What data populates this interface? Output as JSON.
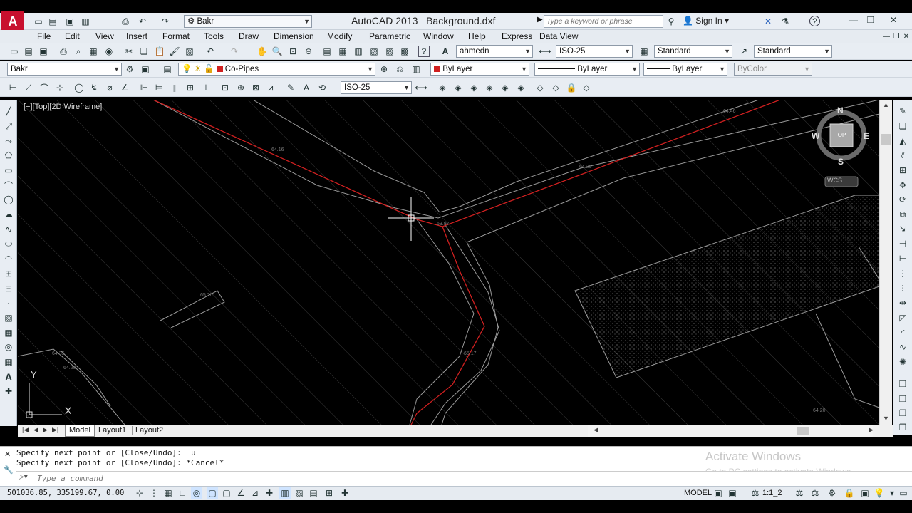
{
  "title_bar": {
    "workspace": "Bakr",
    "app_title": "AutoCAD 2013",
    "file_name": "Background.dxf",
    "search_placeholder": "Type a keyword or phrase",
    "sign_in": "Sign In"
  },
  "menu": {
    "items": [
      "File",
      "Edit",
      "View",
      "Insert",
      "Format",
      "Tools",
      "Draw",
      "Dimension",
      "Modify",
      "Parametric",
      "Window",
      "Help",
      "Express",
      "Data View"
    ]
  },
  "styles_toolbar": {
    "text_style": "ahmedn",
    "dim_style": "ISO-25",
    "table_style": "Standard",
    "multileader_style": "Standard"
  },
  "layers_toolbar": {
    "workspace": "Bakr",
    "layer": "Co-Pipes",
    "color": "ByLayer",
    "linetype": "ByLayer",
    "lineweight": "ByLayer",
    "plot_style": "ByColor"
  },
  "dimension_toolbar": {
    "dim_style": "ISO-25"
  },
  "viewport": {
    "label": "[−][Top][2D Wireframe]",
    "viewcube": {
      "north": "N",
      "south": "S",
      "east": "E",
      "west": "W",
      "face": "TOP",
      "ucs": "WCS"
    },
    "ucs_x": "X",
    "ucs_y": "Y",
    "elevation_labels": [
      "64.46",
      "64.20",
      "64.16",
      "63.97",
      "65.20",
      "64.35",
      "64.20",
      "64.20",
      "65.17"
    ]
  },
  "layout_tabs": [
    "Model",
    "Layout1",
    "Layout2"
  ],
  "command": {
    "history": [
      "Specify next point or [Close/Undo]: _u",
      "Specify next point or [Close/Undo]: *Cancel*"
    ],
    "placeholder": "Type a command",
    "watermark_title": "Activate Windows",
    "watermark_sub": "Go to PC settings to activate Windows."
  },
  "status": {
    "coordinates": "501036.85, 335199.67, 0.00",
    "model": "MODEL",
    "annotation_scale": "1:1_2"
  },
  "colors": {
    "pipe_red": "#d02020",
    "road_grey": "#9a9a9a",
    "hatch": "#3a3a3a"
  }
}
